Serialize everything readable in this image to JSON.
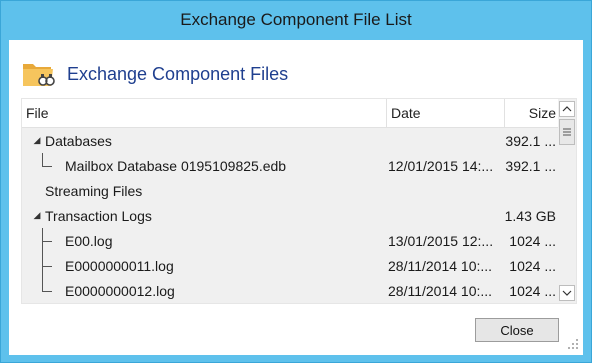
{
  "window": {
    "title": "Exchange Component File List"
  },
  "header": {
    "title": "Exchange Component Files",
    "icon": "folder-search-icon"
  },
  "grid": {
    "columns": [
      "File",
      "Date",
      "Size"
    ],
    "rows": [
      {
        "name": "Databases",
        "date": "",
        "size": "392.1 ...",
        "level": 0,
        "expanded": true
      },
      {
        "name": "Mailbox Database 0195109825.edb",
        "date": "12/01/2015 14:...",
        "size": "392.1 ...",
        "level": 1,
        "expanded": null
      },
      {
        "name": "Streaming Files",
        "date": "",
        "size": "",
        "level": 0,
        "expanded": null
      },
      {
        "name": "Transaction Logs",
        "date": "",
        "size": "1.43 GB",
        "level": 0,
        "expanded": true
      },
      {
        "name": "E00.log",
        "date": "13/01/2015 12:...",
        "size": "1024 ...",
        "level": 1,
        "expanded": null
      },
      {
        "name": "E0000000011.log",
        "date": "28/11/2014 10:...",
        "size": "1024 ...",
        "level": 1,
        "expanded": null
      },
      {
        "name": "E0000000012.log",
        "date": "28/11/2014 10:...",
        "size": "1024 ...",
        "level": 1,
        "expanded": null
      }
    ]
  },
  "buttons": {
    "close_label": "Close"
  },
  "colors": {
    "title_bar": "#5ec1ec",
    "header_text": "#1f3f8f",
    "folder": "#f2b84b"
  }
}
